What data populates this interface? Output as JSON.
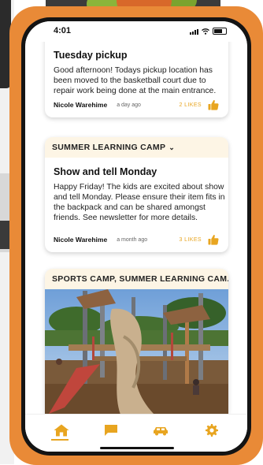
{
  "status_bar": {
    "time": "4:01"
  },
  "posts": [
    {
      "title": "Tuesday pickup",
      "body": "Good afternoon! Todays pickup location has been moved to the basketball court due to repair work being done at the main entrance.",
      "author": "Nicole Warehime",
      "time": "a day ago",
      "likes": "2 LIKES"
    },
    {
      "group": "SUMMER LEARNING CAMP",
      "title": "Show and tell Monday",
      "body": "Happy Friday! The kids are excited about show and tell Monday. Please ensure their item fits in the backpack and can be shared amongst friends. See newsletter for more details.",
      "author": "Nicole Warehime",
      "time": "a month ago",
      "likes": "3 LIKES"
    },
    {
      "group": "SPORTS CAMP, SUMMER LEARNING CAM..."
    }
  ],
  "tabs": [
    "home-icon",
    "chat-icon",
    "car-icon",
    "gear-icon"
  ],
  "colors": {
    "accent": "#e8a520",
    "frame": "#e98a37",
    "group_header_bg": "#fdf5e5"
  }
}
